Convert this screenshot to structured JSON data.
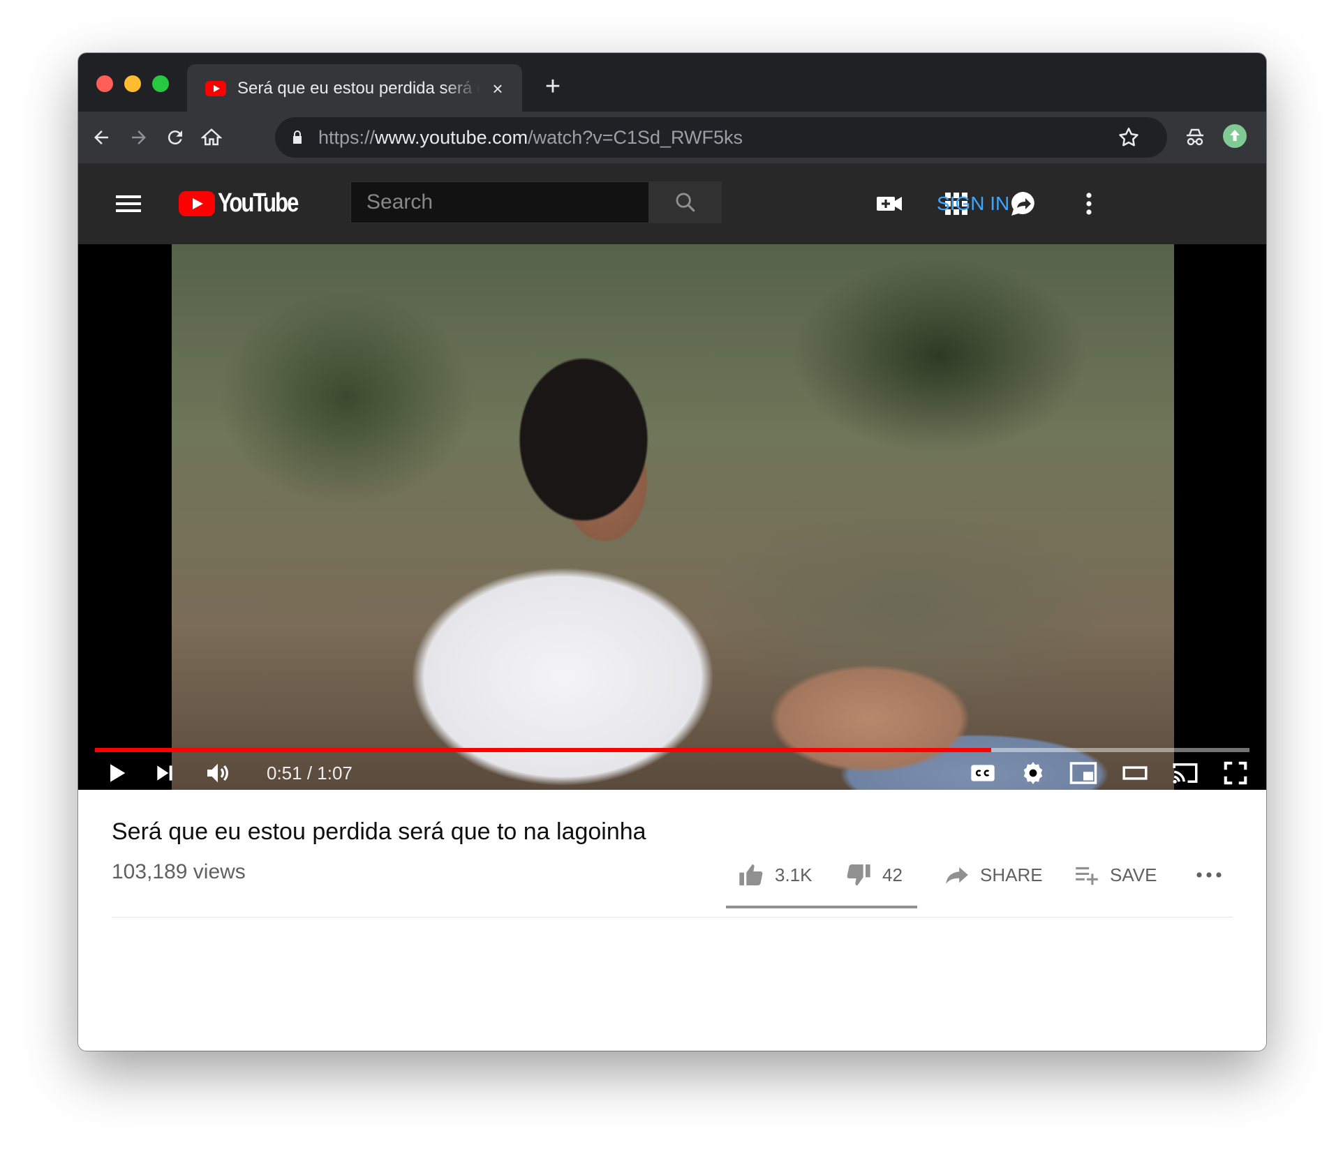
{
  "browser": {
    "tab": {
      "title": "Será que eu estou perdida será que to na lagoinha",
      "close": "×"
    },
    "new_tab": "+",
    "url": {
      "scheme": "https://",
      "host": "www.youtube.com",
      "path": "/watch?v=C1Sd_RWF5ks"
    }
  },
  "masthead": {
    "logo": "YouTube",
    "search_placeholder": "Search",
    "signin": "SIGN IN"
  },
  "player": {
    "time_current": "0:51",
    "time_separator": " / ",
    "time_total": "1:07",
    "progress_fraction": 0.776,
    "progress_color": "#ff0000"
  },
  "video": {
    "title": "Será que eu estou perdida será que to na lagoinha",
    "views": "103,189 views",
    "likes": "3.1K",
    "dislikes": "42",
    "share": "SHARE",
    "save": "SAVE"
  },
  "colors": {
    "accent": "#3ea6ff",
    "brand": "#ff0000"
  }
}
